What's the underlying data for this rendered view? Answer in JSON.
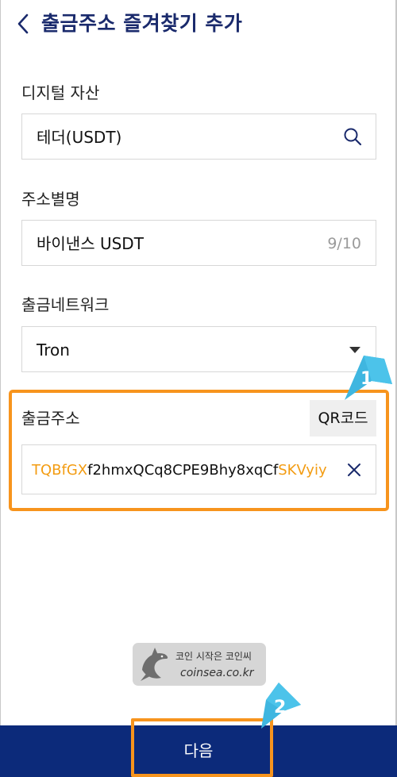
{
  "header": {
    "title": "출금주소 즐겨찾기 추가"
  },
  "asset": {
    "label": "디지털 자산",
    "value": "테더(USDT)"
  },
  "alias": {
    "label": "주소별명",
    "value": "바이낸스 USDT",
    "counter": "9/10"
  },
  "network": {
    "label": "출금네트워크",
    "value": "Tron"
  },
  "address": {
    "label": "출금주소",
    "qr_button": "QR코드",
    "prefix": "TQBfGX",
    "middle": "f2hmxQCq8CPE9Bhy8xqCf",
    "suffix": "SKVyiy"
  },
  "annotations": {
    "step1": "1",
    "step2": "2"
  },
  "watermark": {
    "line1": "코인 시작은 코인씨",
    "line2": "coinsea.co.kr"
  },
  "footer": {
    "next_label": "다음"
  },
  "colors": {
    "title": "#1a2a6c",
    "highlight": "#f39c12",
    "annotation_box": "#f7941d",
    "pointer": "#3fb6e0",
    "footer_bg": "#0c2a7a"
  }
}
